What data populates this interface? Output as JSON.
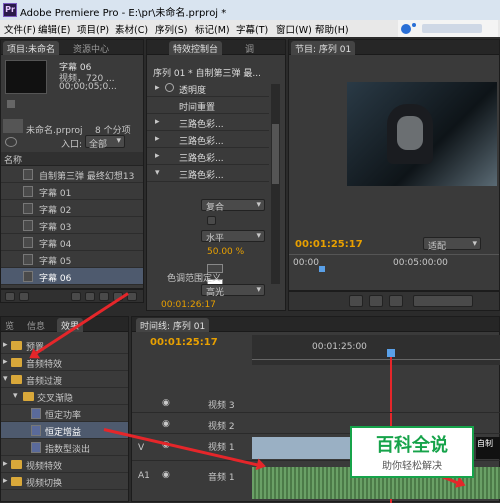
{
  "window": {
    "title": "Adobe Premiere Pro - E:\\pr\\未命名.prproj *"
  },
  "menu": [
    "文件(F)",
    "编辑(E)",
    "项目(P)",
    "素材(C)",
    "序列(S)",
    "标记(M)",
    "字幕(T)",
    "窗口(W)",
    "帮助(H)"
  ],
  "project": {
    "tabs": [
      "项目:未命名",
      "资源中心"
    ],
    "preview": {
      "name": "字幕 06",
      "line1": "视频，720 ...",
      "line2": "00;00;05;0..."
    },
    "file": "未命名.prproj",
    "count": "8 个分项",
    "entry_label": "入口:",
    "entry_value": "全部",
    "col_name": "名称",
    "items": [
      {
        "name": "自制第三弹 最终幻想13",
        "icon": "sequence-icon"
      },
      {
        "name": "字幕 01",
        "icon": "title-icon"
      },
      {
        "name": "字幕 02",
        "icon": "title-icon"
      },
      {
        "name": "字幕 03",
        "icon": "title-icon"
      },
      {
        "name": "字幕 04",
        "icon": "title-icon"
      },
      {
        "name": "字幕 05",
        "icon": "title-icon"
      },
      {
        "name": "字幕 06",
        "icon": "title-icon"
      }
    ]
  },
  "effect_controls": {
    "tabs": [
      "特效控制台",
      "调"
    ],
    "header": "序列 01 * 自制第三弹 最...",
    "props": [
      "透明度",
      "时间重置",
      "三路色彩...",
      "三路色彩...",
      "三路色彩...",
      "三路色彩..."
    ],
    "blend": "复合",
    "mode2": "水平",
    "percent": "50.00 %",
    "range": "色调范围定义",
    "quality": "高光",
    "time": "00:01:26:17"
  },
  "program": {
    "tab": "节目: 序列 01",
    "timecode": "00:01:25:17",
    "fit": "适配",
    "ruler_start": "00:00",
    "ruler_mid": "00:05:00:00"
  },
  "effects": {
    "tabs": [
      "览",
      "信息",
      "效果"
    ],
    "tree": [
      {
        "label": "预置",
        "level": 0,
        "open": false
      },
      {
        "label": "音频特效",
        "level": 0,
        "open": false
      },
      {
        "label": "音频过渡",
        "level": 0,
        "open": true
      },
      {
        "label": "交叉渐隐",
        "level": 1,
        "open": true
      },
      {
        "label": "恒定功率",
        "level": 2,
        "item": true
      },
      {
        "label": "恒定增益",
        "level": 2,
        "item": true
      },
      {
        "label": "指数型淡出",
        "level": 2,
        "item": true
      },
      {
        "label": "视频特效",
        "level": 0,
        "open": false
      },
      {
        "label": "视频切换",
        "level": 0,
        "open": false
      }
    ]
  },
  "timeline": {
    "tab": "时间线: 序列 01",
    "timecode": "00:01:25:17",
    "ruler_mark": "00:01:25:00",
    "tracks": [
      {
        "label": "视频 3",
        "type": "video"
      },
      {
        "label": "视频 2",
        "type": "video"
      },
      {
        "label": "视频 1",
        "type": "video",
        "side": "V"
      },
      {
        "label": "音频 1",
        "type": "audio",
        "side": "A1"
      }
    ],
    "clip_right_label": "自制"
  },
  "watermark": {
    "brand": "百科全说",
    "slogan": "助你轻松解决"
  },
  "colors": {
    "accent": "#e8a000",
    "arrow": "#e5262a",
    "audio": "#6aa066",
    "video": "#9ab0c4"
  }
}
